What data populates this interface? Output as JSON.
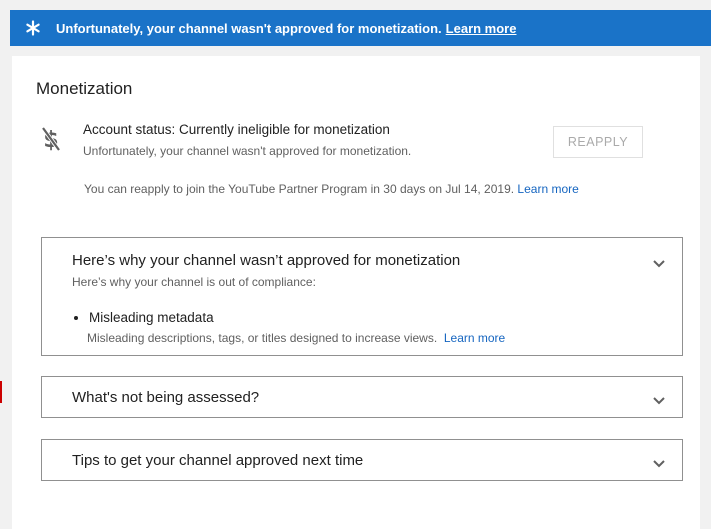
{
  "banner": {
    "message": "Unfortunately, your channel wasn't approved for monetization.",
    "learn_more": "Learn more",
    "icon": "star-icon"
  },
  "monetization": {
    "title": "Monetization",
    "status_main": "Account status: Currently ineligible for monetization",
    "status_sub": "Unfortunately, your channel wasn't approved for monetization.",
    "reapply_label": "REAPPLY",
    "reapply_info": "You can reapply to join the YouTube Partner Program in 30 days on Jul 14, 2019.",
    "reapply_learn_more": "Learn more",
    "icon": "no-dollar-icon"
  },
  "panels": {
    "why": {
      "title": "Here’s why your channel wasn’t approved for monetization",
      "subtitle": "Here’s why your channel is out of compliance:",
      "reason_title": "Misleading metadata",
      "reason_desc": "Misleading descriptions, tags, or titles designed to increase views.",
      "reason_learn_more": "Learn more"
    },
    "not_assessed": {
      "title": "What's not being assessed?"
    },
    "tips": {
      "title": "Tips to get your channel approved next time"
    }
  },
  "colors": {
    "banner_bg": "#1a73c8",
    "link": "#1565c0",
    "page_bg": "#f1f1f1"
  }
}
